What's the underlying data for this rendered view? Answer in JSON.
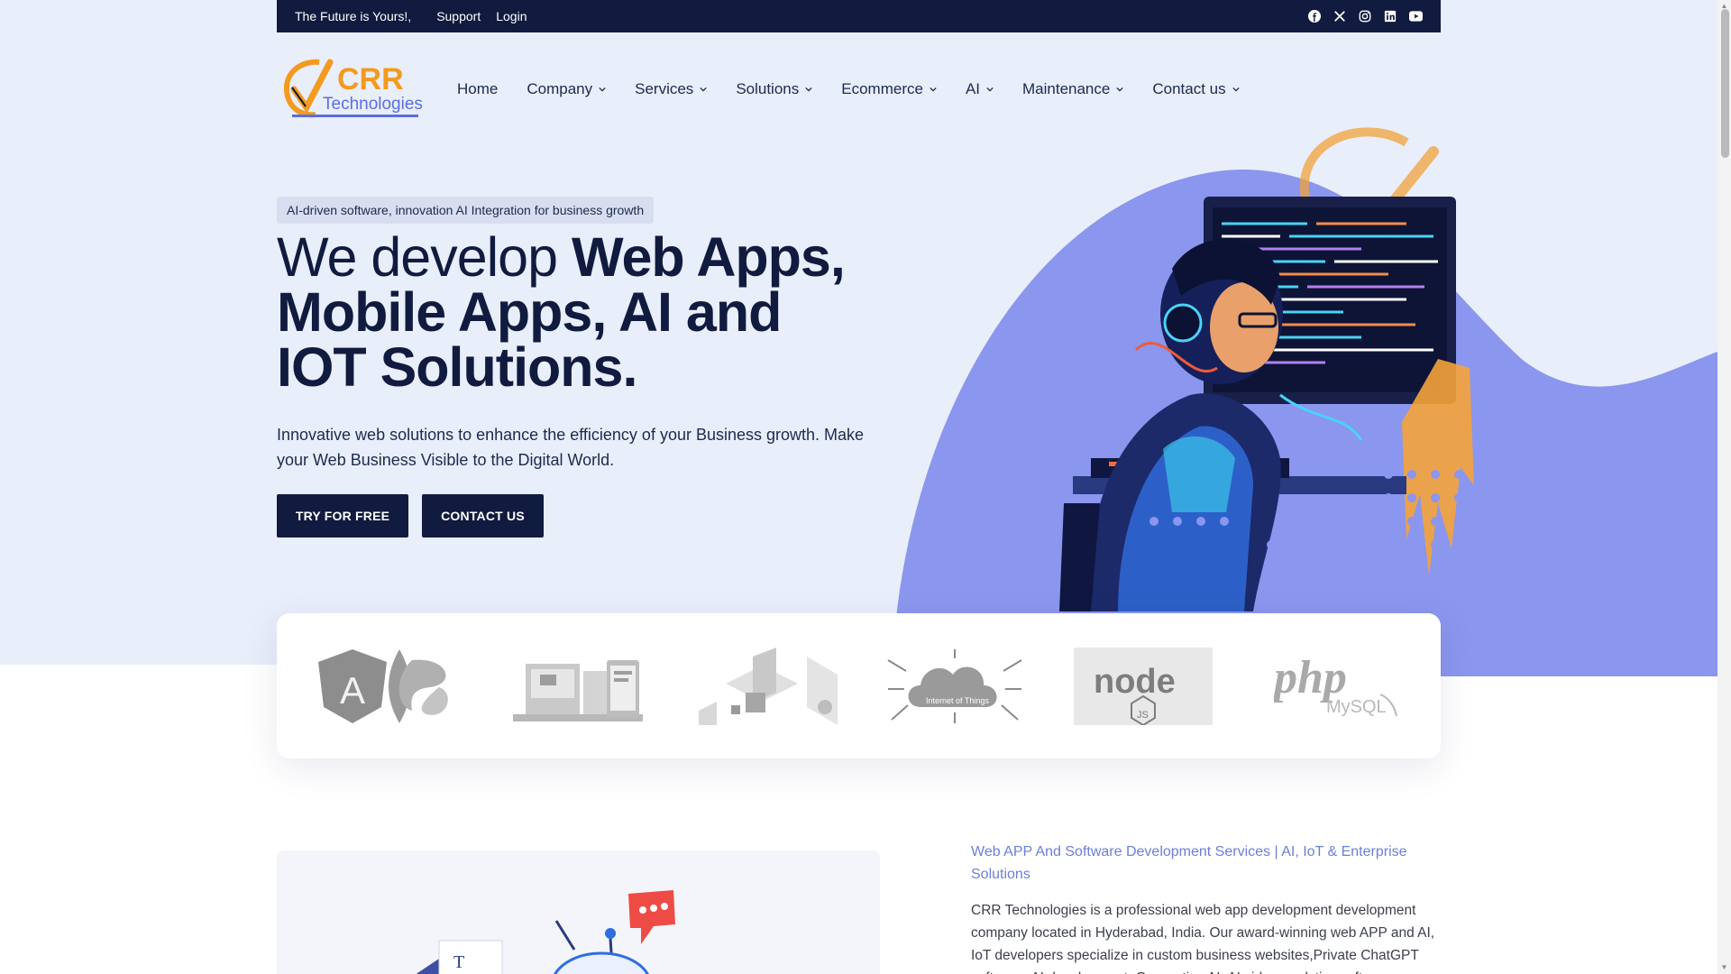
{
  "topbar": {
    "tagline": "The Future is Yours!,",
    "links": [
      "Support",
      "Login"
    ],
    "socials": [
      "facebook-icon",
      "x-icon",
      "instagram-icon",
      "linkedin-icon",
      "youtube-icon"
    ]
  },
  "brand": {
    "logo_top": "CRR",
    "logo_bottom": "Technologies"
  },
  "nav": [
    {
      "label": "Home",
      "dropdown": false
    },
    {
      "label": "Company",
      "dropdown": true
    },
    {
      "label": "Services",
      "dropdown": true
    },
    {
      "label": "Solutions",
      "dropdown": true
    },
    {
      "label": "Ecommerce",
      "dropdown": true
    },
    {
      "label": "AI",
      "dropdown": true
    },
    {
      "label": "Maintenance",
      "dropdown": true
    },
    {
      "label": "Contact us",
      "dropdown": true
    }
  ],
  "hero": {
    "pill": "AI-driven software, innovation AI Integration for business growth",
    "headline_light": "We develop ",
    "headline_bold": "Web Apps, Mobile Apps, AI and IOT Solutions.",
    "lead": "Innovative web solutions to enhance the efficiency of your Business growth. Make your Web Business Visible to the Digital World.",
    "cta_primary": "TRY FOR FREE",
    "cta_secondary": "CONTACT US"
  },
  "tech_logos": {
    "angular_letter": "A",
    "iot_label": "Internet of Things",
    "node_label": "node",
    "node_sub": "JS",
    "php_label": "php",
    "mysql_label": "MySQL"
  },
  "about": {
    "title": "Web APP And Software Development Services | AI, IoT & Enterprise Solutions",
    "body": "CRR Technologies is a professional web app development development company located in Hyderabad, India. Our award-winning web APP and AI, IoT developers specialize in custom business websites,Private ChatGPT software, AI development, Generative AI, AI video analytics software, mean"
  },
  "colors": {
    "navy": "#101b3f",
    "hero_bg": "#e9eefb",
    "blob": "#8b96ee",
    "accent_orange": "#f39a1f",
    "about_title": "#6c7fd8"
  }
}
